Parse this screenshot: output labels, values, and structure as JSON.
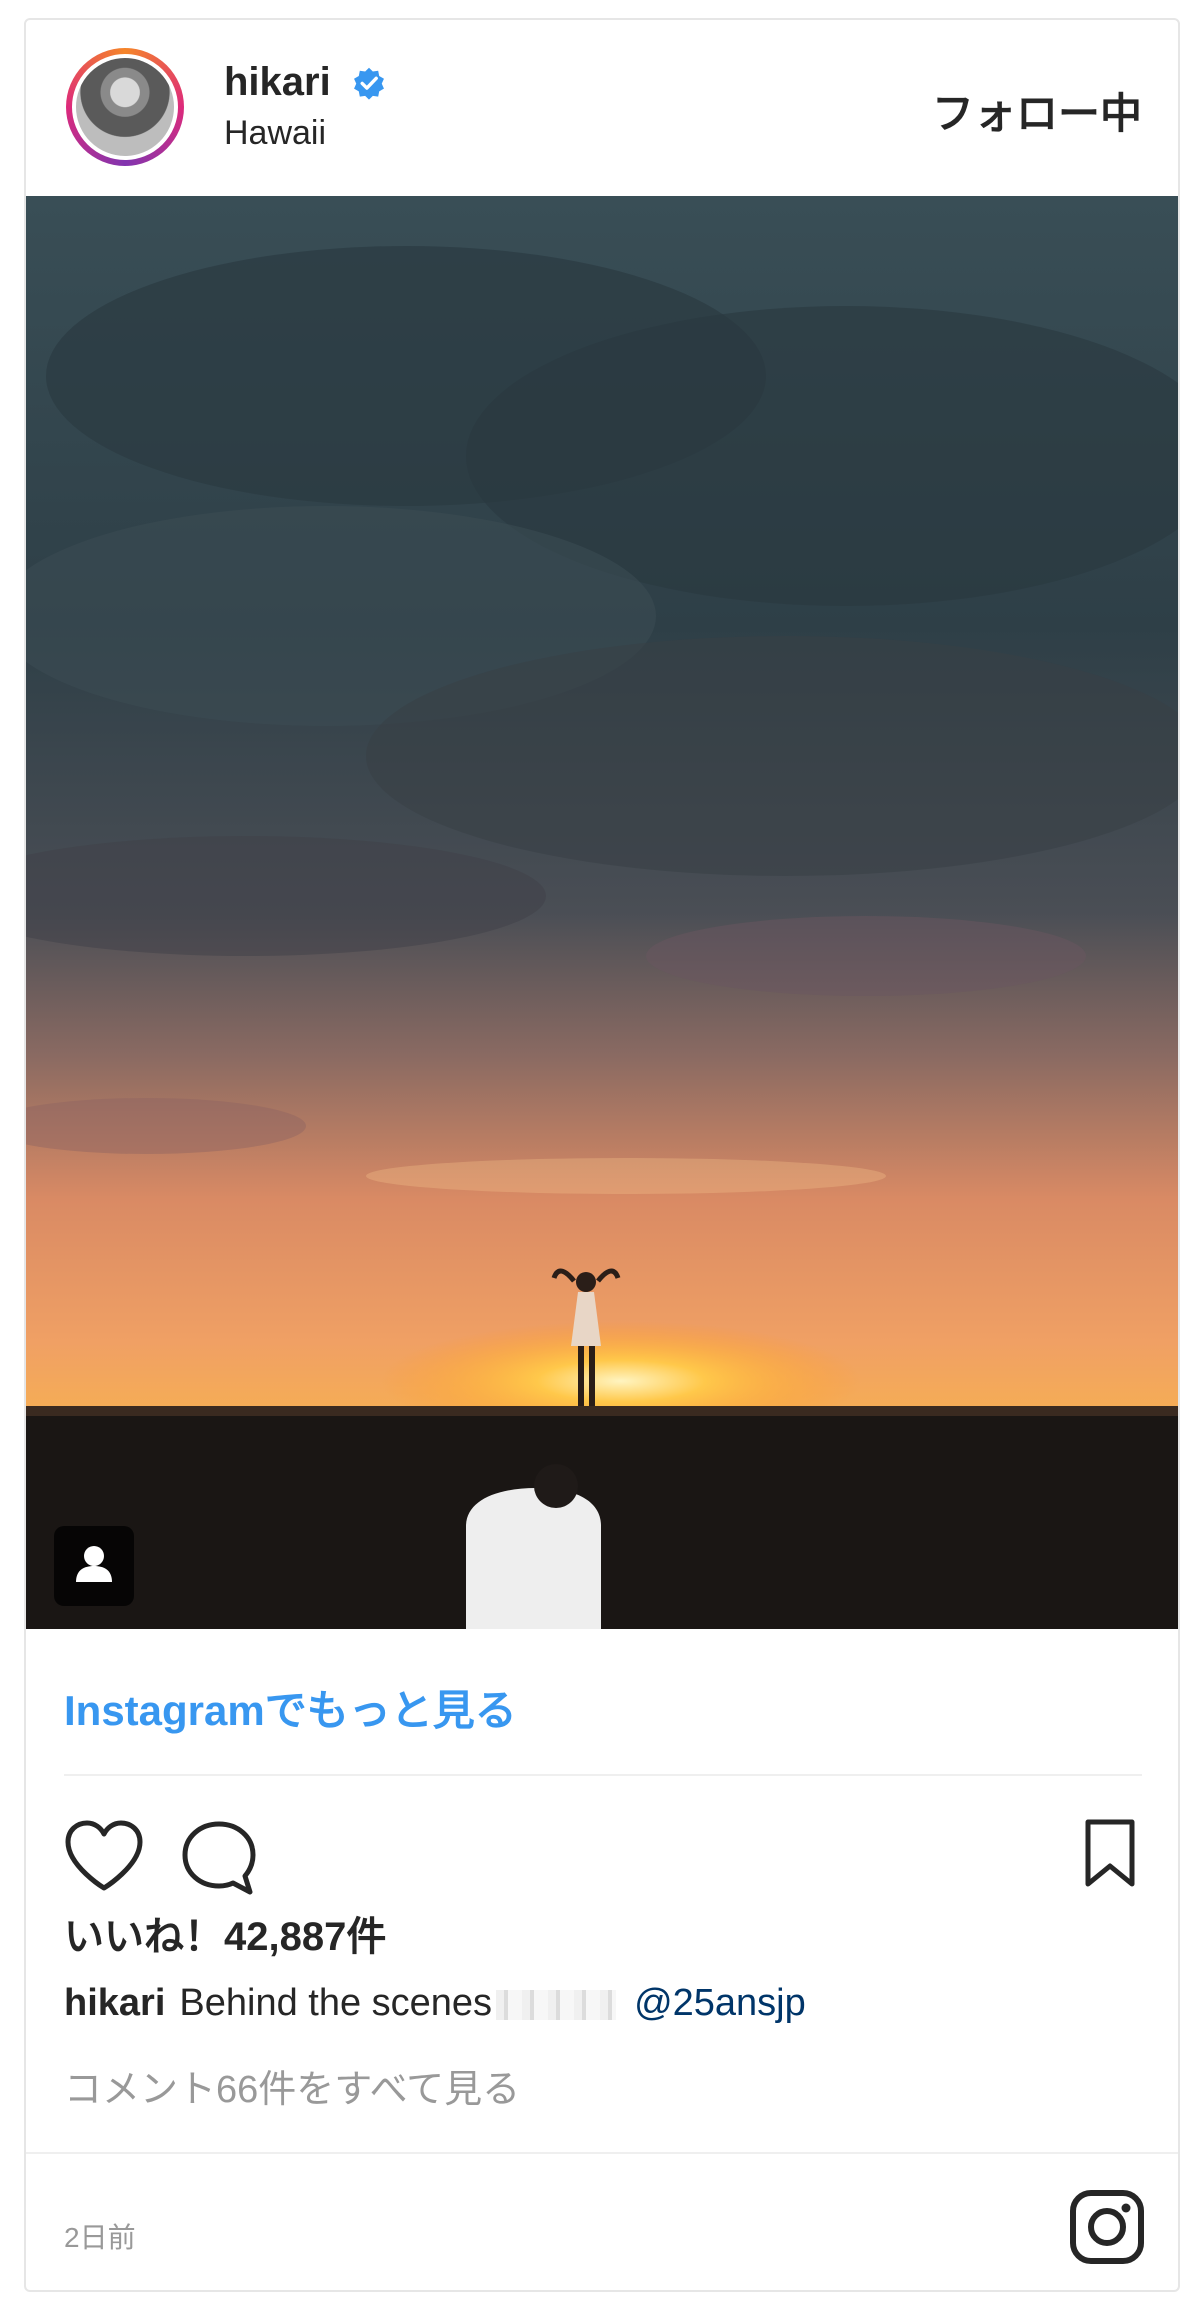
{
  "post": {
    "username": "hikari",
    "location": "Hawaii",
    "follow_label": "フォロー中",
    "more_link": "Instagramでもっと見る",
    "likes": "いいね！42,887件",
    "caption_user": "hikari",
    "caption_text": "Behind the scenes",
    "caption_mention": "@25ansjp",
    "comments_link": "コメント66件をすべて見る",
    "timestamp": "2日前"
  },
  "icons": {
    "verified": "verified-badge-icon",
    "like": "heart-icon",
    "comment": "comment-bubble-icon",
    "save": "bookmark-icon",
    "tag": "user-tag-icon",
    "brand": "instagram-logo-icon"
  },
  "colors": {
    "link": "#3897f0",
    "verified": "#3897f0",
    "text": "#262626",
    "muted": "#999999",
    "mention": "#003569"
  }
}
